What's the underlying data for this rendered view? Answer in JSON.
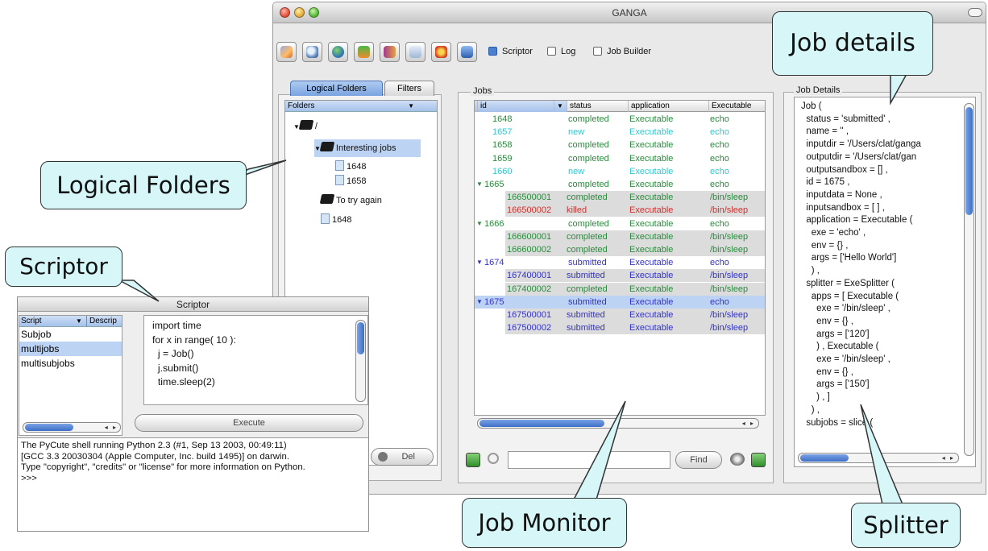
{
  "window": {
    "title": "GANGA",
    "toolbar": {
      "icons": [
        "edit-icon",
        "search-icon",
        "globe-icon",
        "tree-icon",
        "book-icon",
        "copy-icon",
        "stop-icon",
        "database-icon"
      ],
      "checks": [
        {
          "label": "Scriptor",
          "checked": true
        },
        {
          "label": "Log",
          "checked": false
        },
        {
          "label": "Job Builder",
          "checked": false
        }
      ]
    }
  },
  "left_panel": {
    "tabs": [
      "Logical Folders",
      "Filters"
    ],
    "tree_header": "Folders",
    "tree": [
      {
        "label": "/"
      },
      {
        "label": "Interesting jobs"
      },
      {
        "label": "1648"
      },
      {
        "label": "1658"
      },
      {
        "label": "To try again"
      },
      {
        "label": "1648"
      }
    ],
    "del_button": "Del"
  },
  "jobs": {
    "group_label": "Jobs",
    "columns": [
      "id",
      "status",
      "application",
      "Executable"
    ],
    "rows": [
      {
        "id": "1648",
        "status": "completed",
        "application": "Executable",
        "exe": "echo",
        "color": "#2b8a3e",
        "expand": "",
        "indent": 1,
        "shade": false
      },
      {
        "id": "1657",
        "status": "new",
        "application": "Executable",
        "exe": "echo",
        "color": "#34c6cf",
        "expand": "",
        "indent": 1,
        "shade": false
      },
      {
        "id": "1658",
        "status": "completed",
        "application": "Executable",
        "exe": "echo",
        "color": "#2b8a3e",
        "expand": "",
        "indent": 1,
        "shade": false
      },
      {
        "id": "1659",
        "status": "completed",
        "application": "Executable",
        "exe": "echo",
        "color": "#2b8a3e",
        "expand": "",
        "indent": 1,
        "shade": false
      },
      {
        "id": "1660",
        "status": "new",
        "application": "Executable",
        "exe": "echo",
        "color": "#34c6cf",
        "expand": "",
        "indent": 1,
        "shade": false
      },
      {
        "id": "1665",
        "status": "completed",
        "application": "Executable",
        "exe": "echo",
        "color": "#2b8a3e",
        "expand": "▼",
        "indent": 0,
        "shade": false
      },
      {
        "id": "166500001",
        "status": "completed",
        "application": "Executable",
        "exe": "/bin/sleep",
        "color": "#2b8a3e",
        "expand": "",
        "indent": 2,
        "shade": true
      },
      {
        "id": "166500002",
        "status": "killed",
        "application": "Executable",
        "exe": "/bin/sleep",
        "color": "#d0312d",
        "expand": "",
        "indent": 2,
        "shade": true
      },
      {
        "id": "1666",
        "status": "completed",
        "application": "Executable",
        "exe": "echo",
        "color": "#2b8a3e",
        "expand": "▼",
        "indent": 0,
        "shade": false
      },
      {
        "id": "166600001",
        "status": "completed",
        "application": "Executable",
        "exe": "/bin/sleep",
        "color": "#2b8a3e",
        "expand": "",
        "indent": 2,
        "shade": true
      },
      {
        "id": "166600002",
        "status": "completed",
        "application": "Executable",
        "exe": "/bin/sleep",
        "color": "#2b8a3e",
        "expand": "",
        "indent": 2,
        "shade": true
      },
      {
        "id": "1674",
        "status": "submitted",
        "application": "Executable",
        "exe": "echo",
        "color": "#3232c8",
        "expand": "▼",
        "indent": 0,
        "shade": false
      },
      {
        "id": "167400001",
        "status": "submitted",
        "application": "Executable",
        "exe": "/bin/sleep",
        "color": "#3232c8",
        "expand": "",
        "indent": 2,
        "shade": true
      },
      {
        "id": "167400002",
        "status": "completed",
        "application": "Executable",
        "exe": "/bin/sleep",
        "color": "#2b8a3e",
        "expand": "",
        "indent": 2,
        "shade": true
      },
      {
        "id": "1675",
        "status": "submitted",
        "application": "Executable",
        "exe": "echo",
        "color": "#3232c8",
        "expand": "▼",
        "indent": 0,
        "shade": false,
        "selected": true
      },
      {
        "id": "167500001",
        "status": "submitted",
        "application": "Executable",
        "exe": "/bin/sleep",
        "color": "#3232c8",
        "expand": "",
        "indent": 2,
        "shade": true
      },
      {
        "id": "167500002",
        "status": "submitted",
        "application": "Executable",
        "exe": "/bin/sleep",
        "color": "#3232c8",
        "expand": "",
        "indent": 2,
        "shade": true
      }
    ],
    "find_button": "Find"
  },
  "details": {
    "group_label": "Job Details",
    "text": "Job (\n  status = 'submitted' ,\n  name = '' ,\n  inputdir = '/Users/clat/ganga\n  outputdir = '/Users/clat/gan\n  outputsandbox = [] ,\n  id = 1675 ,\n  inputdata = None ,\n  inputsandbox = [ ] ,\n  application = Executable (\n    exe = 'echo' ,\n    env = {} ,\n    args = ['Hello World']\n    ) ,\n  splitter = ExeSplitter (\n    apps = [ Executable (\n      exe = '/bin/sleep' ,\n      env = {} ,\n      args = ['120']\n      ) , Executable (\n      exe = '/bin/sleep' ,\n      env = {} ,\n      args = ['150']\n      ) , ]\n    ) ,\n  subjobs = slice ("
  },
  "scriptor": {
    "title": "Scriptor",
    "list_header": [
      "Script",
      "Descrip"
    ],
    "scripts": [
      "Subjob",
      "multijobs",
      "multisubjobs"
    ],
    "selected_index": 1,
    "code": "import time\nfor x in range( 10 ):\n  j = Job()\n  j.submit()\n  time.sleep(2)",
    "execute_button": "Execute",
    "shell_text": "The PyCute shell running Python 2.3 (#1, Sep 13 2003, 00:49:11)\n[GCC 3.3 20030304 (Apple Computer, Inc. build 1495)] on darwin.\nType \"copyright\", \"credits\" or \"license\" for more information on Python.\n>>>"
  },
  "callouts": {
    "job_details": "Job details",
    "logical_folders": "Logical Folders",
    "scriptor": "Scriptor",
    "job_monitor": "Job Monitor",
    "splitter": "Splitter"
  },
  "colors": {
    "callout_bg": "#d6f6f8",
    "selection": "#bcd3f4",
    "completed": "#2b8a3e",
    "new": "#34c6cf",
    "killed": "#d0312d",
    "submitted": "#3232c8"
  }
}
